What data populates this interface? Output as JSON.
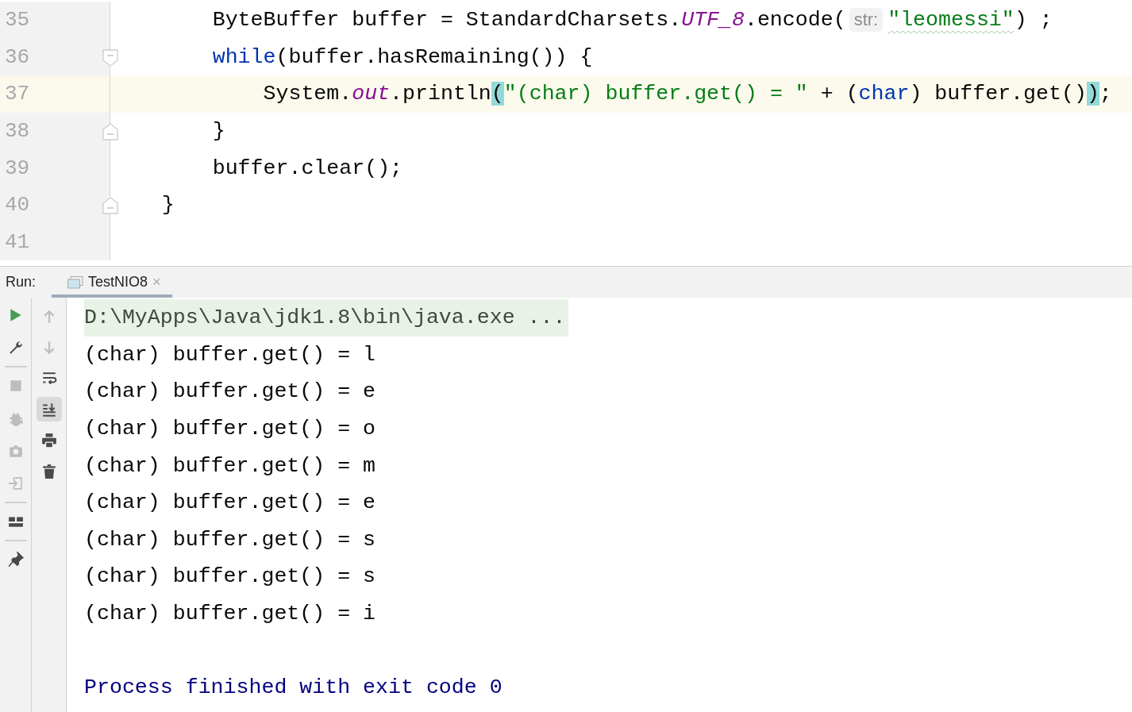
{
  "editor": {
    "lines": [
      {
        "number": "35",
        "kind": "plain",
        "current": false,
        "tokens": [
          {
            "kind": "plain",
            "text": "        ByteBuffer buffer = StandardCharsets."
          },
          {
            "kind": "field",
            "text": "UTF_8"
          },
          {
            "kind": "plain",
            "text": ".encode("
          },
          {
            "kind": "hint",
            "text": "str:"
          },
          {
            "kind": "typo-string",
            "text": "\"leomessi\""
          },
          {
            "kind": "plain",
            "text": ") ;"
          }
        ]
      },
      {
        "number": "36",
        "kind": "fold-start",
        "current": false,
        "tokens": [
          {
            "kind": "keyword",
            "text": "        while"
          },
          {
            "kind": "plain",
            "text": "(buffer.hasRemaining()) {"
          }
        ]
      },
      {
        "number": "37",
        "kind": "plain",
        "current": true,
        "tokens": [
          {
            "kind": "plain",
            "text": "            System."
          },
          {
            "kind": "field",
            "text": "out"
          },
          {
            "kind": "plain",
            "text": ".println"
          },
          {
            "kind": "brace-match",
            "text": "("
          },
          {
            "kind": "string",
            "text": "\"(char) buffer.get() = \""
          },
          {
            "kind": "plain",
            "text": " + ("
          },
          {
            "kind": "keyword",
            "text": "char"
          },
          {
            "kind": "plain",
            "text": ") buffer.get()"
          },
          {
            "kind": "brace-match",
            "text": ")"
          },
          {
            "kind": "plain",
            "text": ";"
          }
        ]
      },
      {
        "number": "38",
        "kind": "fold-end",
        "current": false,
        "tokens": [
          {
            "kind": "plain",
            "text": "        }"
          }
        ]
      },
      {
        "number": "39",
        "kind": "plain",
        "current": false,
        "tokens": [
          {
            "kind": "plain",
            "text": "        buffer.clear();"
          }
        ]
      },
      {
        "number": "40",
        "kind": "fold-end",
        "current": false,
        "tokens": [
          {
            "kind": "plain",
            "text": "    }"
          }
        ]
      },
      {
        "number": "41",
        "kind": "plain",
        "current": false
      }
    ]
  },
  "run_panel": {
    "label": "Run:",
    "tabs": [
      {
        "title": "TestNIO8",
        "selected": true,
        "close": "×"
      }
    ],
    "left_toolbar": [
      {
        "kind": "run",
        "disabled": false
      },
      {
        "kind": "wrench",
        "disabled": false
      },
      {
        "kind": "separator"
      },
      {
        "kind": "stop",
        "disabled": true
      },
      {
        "kind": "debug",
        "disabled": true
      },
      {
        "kind": "camera",
        "disabled": true
      },
      {
        "kind": "exit",
        "disabled": true
      },
      {
        "kind": "separator"
      },
      {
        "kind": "layout",
        "disabled": false
      },
      {
        "kind": "separator"
      },
      {
        "kind": "pin",
        "disabled": false
      }
    ],
    "console_toolbar": [
      {
        "kind": "up",
        "disabled": true,
        "toggled": false
      },
      {
        "kind": "down",
        "disabled": true,
        "toggled": false
      },
      {
        "kind": "wrap",
        "disabled": false,
        "toggled": false
      },
      {
        "kind": "scroll-end",
        "disabled": false,
        "toggled": true
      },
      {
        "kind": "print",
        "disabled": false,
        "toggled": false
      },
      {
        "kind": "trash",
        "disabled": false,
        "toggled": false
      }
    ],
    "console": [
      {
        "kind": "command",
        "text": "D:\\MyApps\\Java\\jdk1.8\\bin\\java.exe ..."
      },
      {
        "kind": "output",
        "text": "(char) buffer.get() = l"
      },
      {
        "kind": "output",
        "text": "(char) buffer.get() = e"
      },
      {
        "kind": "output",
        "text": "(char) buffer.get() = o"
      },
      {
        "kind": "output",
        "text": "(char) buffer.get() = m"
      },
      {
        "kind": "output",
        "text": "(char) buffer.get() = e"
      },
      {
        "kind": "output",
        "text": "(char) buffer.get() = s"
      },
      {
        "kind": "output",
        "text": "(char) buffer.get() = s"
      },
      {
        "kind": "output",
        "text": "(char) buffer.get() = i"
      },
      {
        "kind": "blank"
      },
      {
        "kind": "exit",
        "text": "Process finished with exit code 0"
      }
    ]
  }
}
